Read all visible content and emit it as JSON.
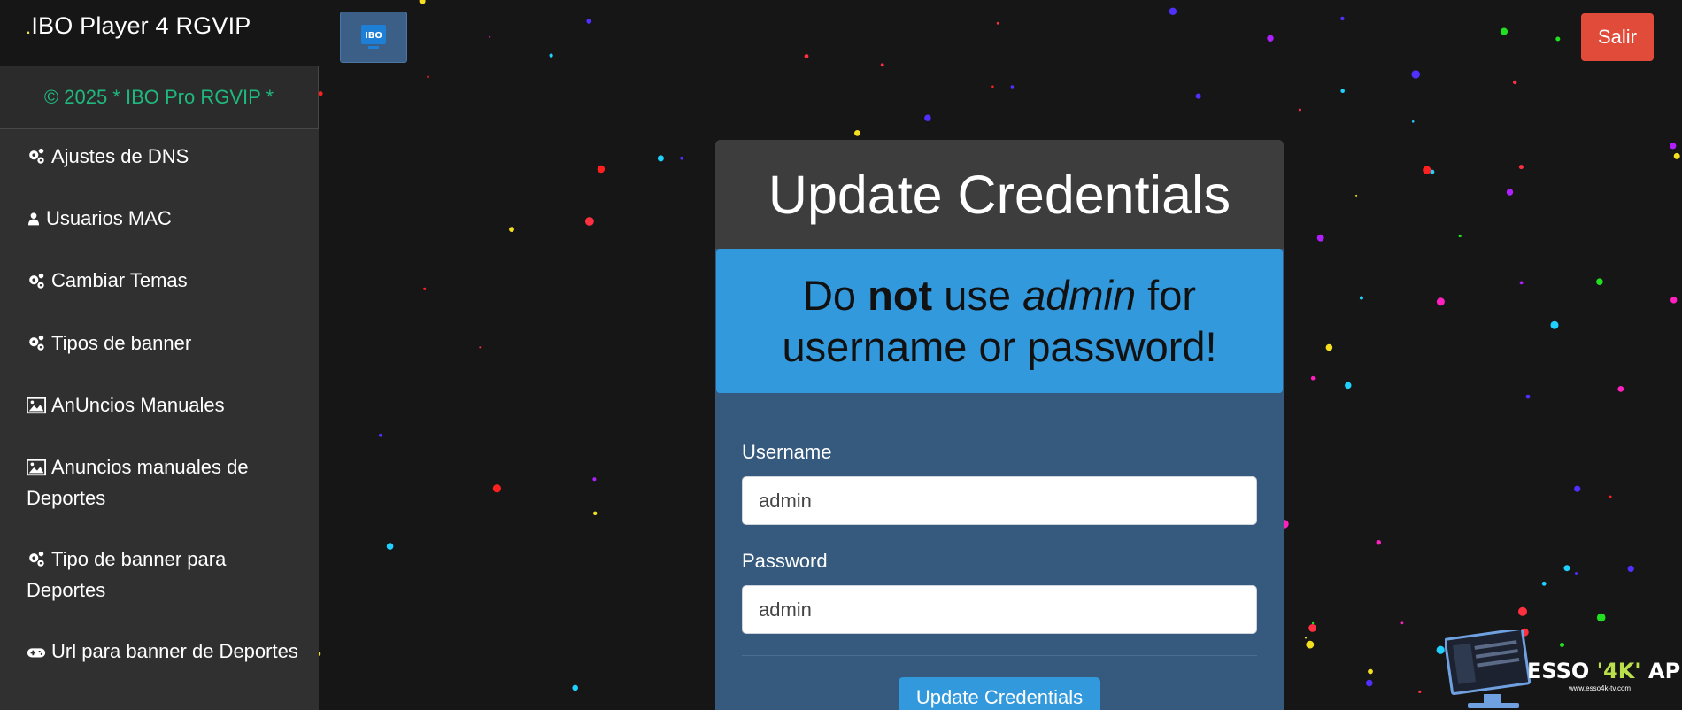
{
  "header": {
    "brand": "IBO Player 4 RGVIP",
    "logo_icon": "tv-logo-icon",
    "logout_label": "Salir",
    "logout_color": "#e04b3a"
  },
  "sidebar": {
    "copyright": "© 2025 * IBO Pro RGVIP *",
    "copyright_color": "#1fb97e",
    "items": [
      {
        "label": "Ajustes de DNS",
        "icon": "gears-icon"
      },
      {
        "label": "Usuarios MAC",
        "icon": "user-icon"
      },
      {
        "label": "Cambiar Temas",
        "icon": "gears-icon"
      },
      {
        "label": "Tipos de banner",
        "icon": "gears-icon"
      },
      {
        "label": "AnUncios Manuales",
        "icon": "image-icon"
      },
      {
        "label": "Anuncios manuales de Deportes",
        "icon": "image-icon"
      },
      {
        "label": "Tipo de banner para Deportes",
        "icon": "gears-icon"
      },
      {
        "label": "Url para banner de Deportes",
        "icon": "gamepad-icon"
      }
    ]
  },
  "card": {
    "title": "Update Credentials",
    "warning": {
      "pre": "Do ",
      "bold": "not",
      "mid": " use ",
      "italic": "admin",
      "post": " for username or password!"
    },
    "username_label": "Username",
    "username_value": "admin",
    "password_label": "Password",
    "password_value": "admin",
    "submit_label": "Update Credentials",
    "accent": "#3399dd"
  },
  "watermark": {
    "brand_pre": "ESSO ",
    "brand_mid": "'4K'",
    "brand_post": " APPS",
    "url": "www.esso4k-tv.com"
  }
}
